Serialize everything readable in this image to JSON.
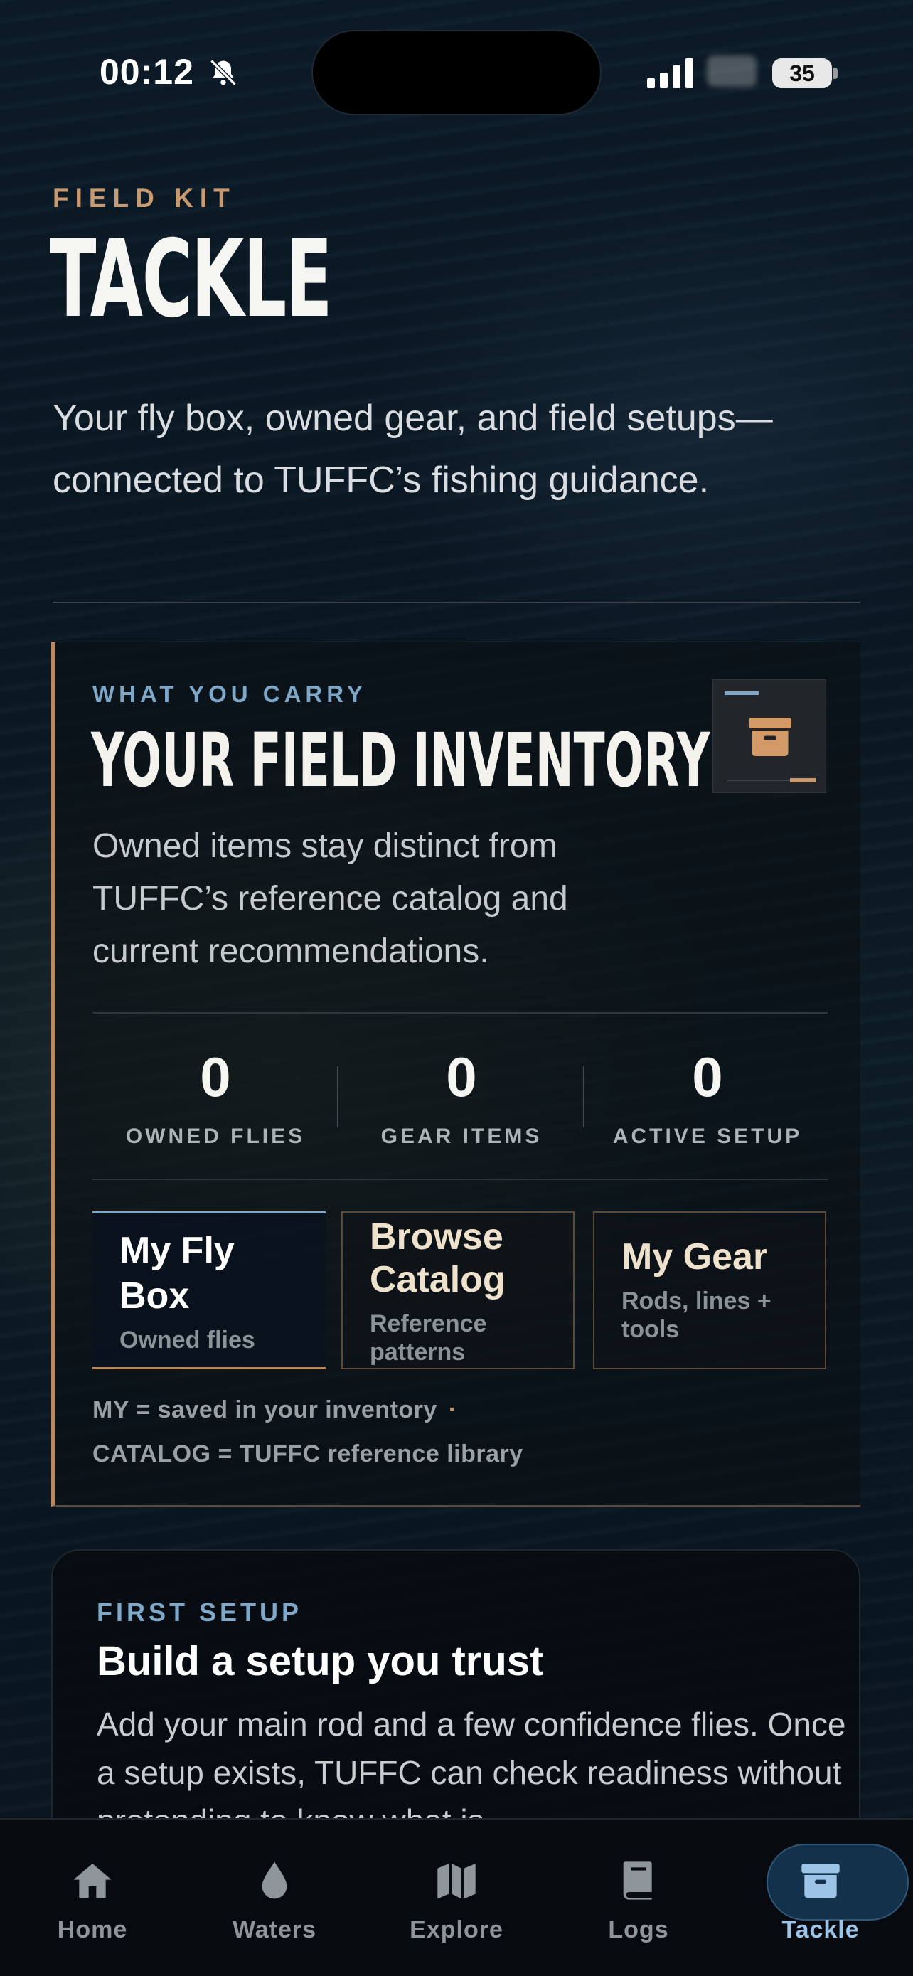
{
  "status_bar": {
    "time": "00:12",
    "battery": "35"
  },
  "header": {
    "eyebrow": "FIELD KIT",
    "title": "TACKLE",
    "intro": "Your fly box, owned gear, and field setups—connected to TUFFC’s fishing guidance."
  },
  "inventory": {
    "eyebrow": "WHAT YOU CARRY",
    "title": "YOUR FIELD INVENTORY",
    "description": "Owned items stay distinct from TUFFC’s reference catalog and current recommendations.",
    "icon": "archive-box-icon",
    "stats": [
      {
        "value": "0",
        "label": "OWNED FLIES"
      },
      {
        "value": "0",
        "label": "GEAR ITEMS"
      },
      {
        "value": "0",
        "label": "ACTIVE SETUP"
      }
    ],
    "tiles": [
      {
        "title_line1": "My Fly",
        "title_line2": "Box",
        "subtitle": "Owned flies"
      },
      {
        "title_line1": "Browse",
        "title_line2": "Catalog",
        "subtitle_line1": "Reference",
        "subtitle_line2": "patterns"
      },
      {
        "title": "My Gear",
        "subtitle_line1": "Rods, lines +",
        "subtitle_line2": "tools"
      }
    ],
    "legend": {
      "my": "MY = saved in your inventory",
      "dot": "·",
      "catalog": "CATALOG = TUFFC reference library"
    }
  },
  "setup": {
    "eyebrow": "FIRST SETUP",
    "title": "Build a setup you trust",
    "description": "Add your main rod and a few confidence flies. Once a setup exists, TUFFC can check readiness without pretending to know what is"
  },
  "tab_bar": {
    "active": "Tackle",
    "tabs": [
      {
        "label": "Home",
        "icon": "home-icon"
      },
      {
        "label": "Waters",
        "icon": "water-drop-icon"
      },
      {
        "label": "Explore",
        "icon": "map-icon"
      },
      {
        "label": "Logs",
        "icon": "book-icon"
      },
      {
        "label": "Tackle",
        "icon": "archive-box-icon"
      }
    ]
  },
  "colors": {
    "accent_copper": "#c99a70",
    "accent_blue": "#7fa7c8",
    "background": "#0a1722"
  }
}
